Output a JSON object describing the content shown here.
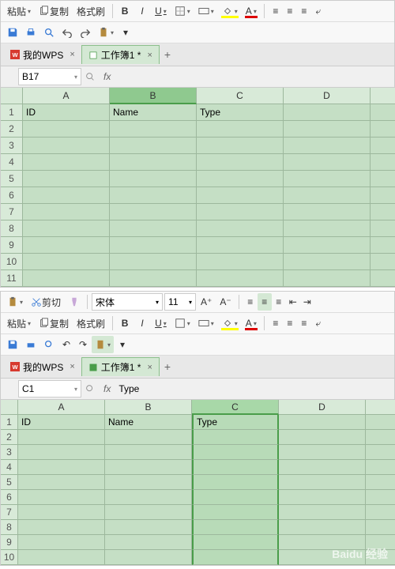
{
  "panel1": {
    "toolbar": {
      "paste": "粘贴",
      "copy_label": "复制",
      "fmt_painter": "格式刷",
      "bold": "B",
      "italic": "I",
      "underline": "U",
      "font_color": "A",
      "highlight": "A"
    },
    "tabs": {
      "my_wps": "我的WPS",
      "workbook": "工作簿1 *"
    },
    "namebox": "B17",
    "fx_value": "",
    "columns": [
      "A",
      "B",
      "C",
      "D"
    ],
    "rows": [
      "1",
      "2",
      "3",
      "4",
      "5",
      "6",
      "7",
      "8",
      "9",
      "10",
      "11"
    ],
    "data": {
      "A1": "ID",
      "B1": "Name",
      "C1": "Type"
    },
    "selected_col": "B"
  },
  "panel2": {
    "toolbar": {
      "paste": "粘贴",
      "cut": "剪切",
      "copy_label": "复制",
      "fmt_painter": "格式刷",
      "font": "宋体",
      "size": "11",
      "bold": "B",
      "italic": "I",
      "underline": "U",
      "font_color": "A",
      "highlight": "A",
      "grow": "A⁺",
      "shrink": "A⁻"
    },
    "tabs": {
      "my_wps": "我的WPS",
      "workbook": "工作簿1 *"
    },
    "namebox": "C1",
    "fx_value": "Type",
    "columns": [
      "A",
      "B",
      "C",
      "D"
    ],
    "rows": [
      "1",
      "2",
      "3",
      "4",
      "5",
      "6",
      "7",
      "8",
      "9",
      "10"
    ],
    "data": {
      "A1": "ID",
      "B1": "Name",
      "C1": "Type"
    },
    "selected_col": "C"
  },
  "watermark": "Baidu 经验"
}
